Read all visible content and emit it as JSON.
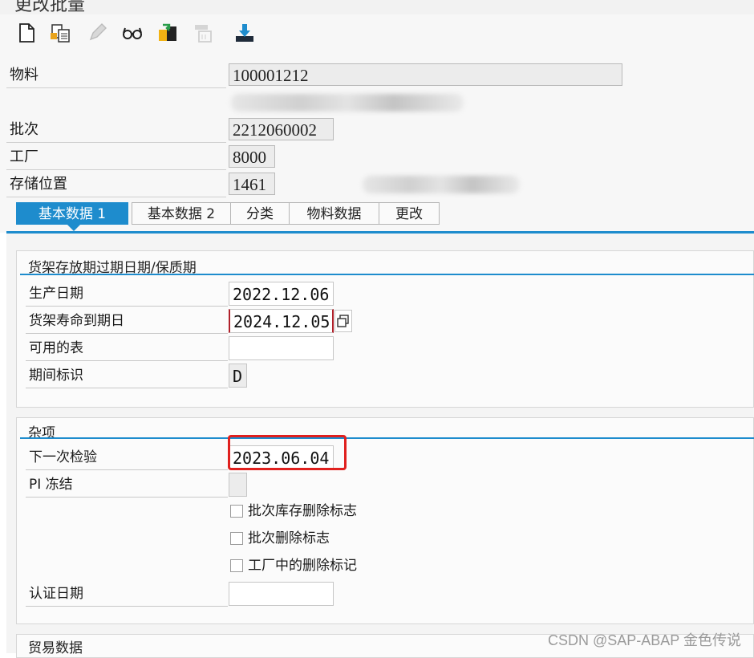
{
  "window": {
    "title": "更改批量"
  },
  "toolbar": {
    "icons": [
      "new-document-icon",
      "display-other-icon",
      "edit-pencil-icon",
      "glasses-display-icon",
      "classification-icon",
      "copy-disabled-icon",
      "download-icon"
    ]
  },
  "header": {
    "material_label": "物料",
    "material_value": "100001212",
    "batch_label": "批次",
    "batch_value": "2212060002",
    "plant_label": "工厂",
    "plant_value": "8000",
    "storage_label": "存储位置",
    "storage_value": "1461"
  },
  "tabs": [
    {
      "label": "基本数据 1",
      "active": true
    },
    {
      "label": "基本数据 2",
      "active": false
    },
    {
      "label": "分类",
      "active": false
    },
    {
      "label": "物料数据",
      "active": false
    },
    {
      "label": "更改",
      "active": false
    }
  ],
  "shelf_life": {
    "title": "货架存放期过期日期/保质期",
    "production_date_label": "生产日期",
    "production_date_value": "2022.12.06",
    "expiry_label": "货架寿命到期日",
    "expiry_value": "2024.12.05",
    "available_label": "可用的表",
    "available_value": "",
    "period_label": "期间标识",
    "period_value": "D"
  },
  "misc": {
    "title": "杂项",
    "next_inspection_label": "下一次检验",
    "next_inspection_value": "2023.06.04",
    "pi_freeze_label": "PI 冻结",
    "chk_batch_stock_deletion": "批次库存删除标志",
    "chk_batch_deletion": "批次删除标志",
    "chk_plant_deletion": "工厂中的删除标记",
    "cert_date_label": "认证日期",
    "cert_date_value": ""
  },
  "trade": {
    "title": "贸易数据"
  },
  "watermark": "CSDN @SAP-ABAP 金色传说",
  "colors": {
    "accent": "#1e8ccd",
    "highlight": "#e0201e",
    "header_bg": "#f7f7f7"
  }
}
